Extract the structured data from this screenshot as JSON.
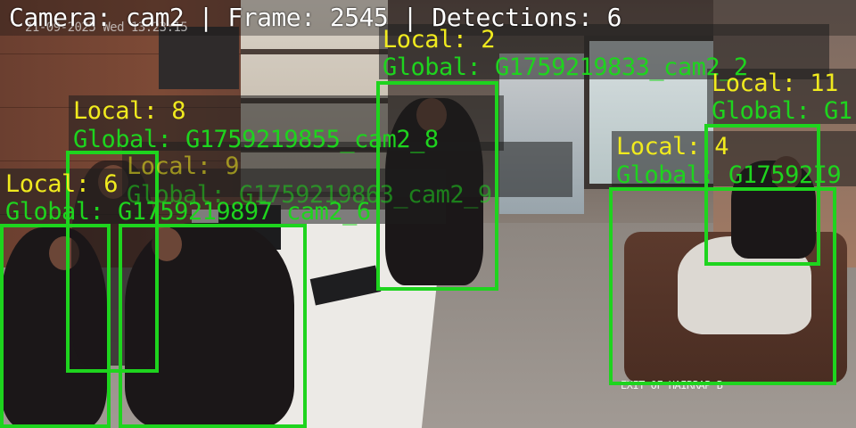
{
  "header": {
    "text": "Camera: cam2 | Frame: 2545 | Detections: 6",
    "camera": "cam2",
    "frame": 2545,
    "detections": 6
  },
  "camera_timestamp": "21-09-2025 Wed 13:23:15",
  "floor_sign": "EXIT OF HAIRRAP B",
  "colors": {
    "local_label": "#f0ea1e",
    "global_label": "#1ed41e",
    "box": "#1ed41e",
    "header": "#ffffff"
  },
  "detections": [
    {
      "local": "Local: 2",
      "global": "Global: G1759219833_cam2_2"
    },
    {
      "local": "Local: 11",
      "global": "Global: G1"
    },
    {
      "local": "Local: 8",
      "global": "Global: G1759219855_cam2_8"
    },
    {
      "local": "Local: 9",
      "global": "Global: G1759219863_cam2_9"
    },
    {
      "local": "Local: 4",
      "global": "Global: G17592I9"
    },
    {
      "local": "Local: 6",
      "global": "Global: G1759219897_cam2_6"
    }
  ]
}
